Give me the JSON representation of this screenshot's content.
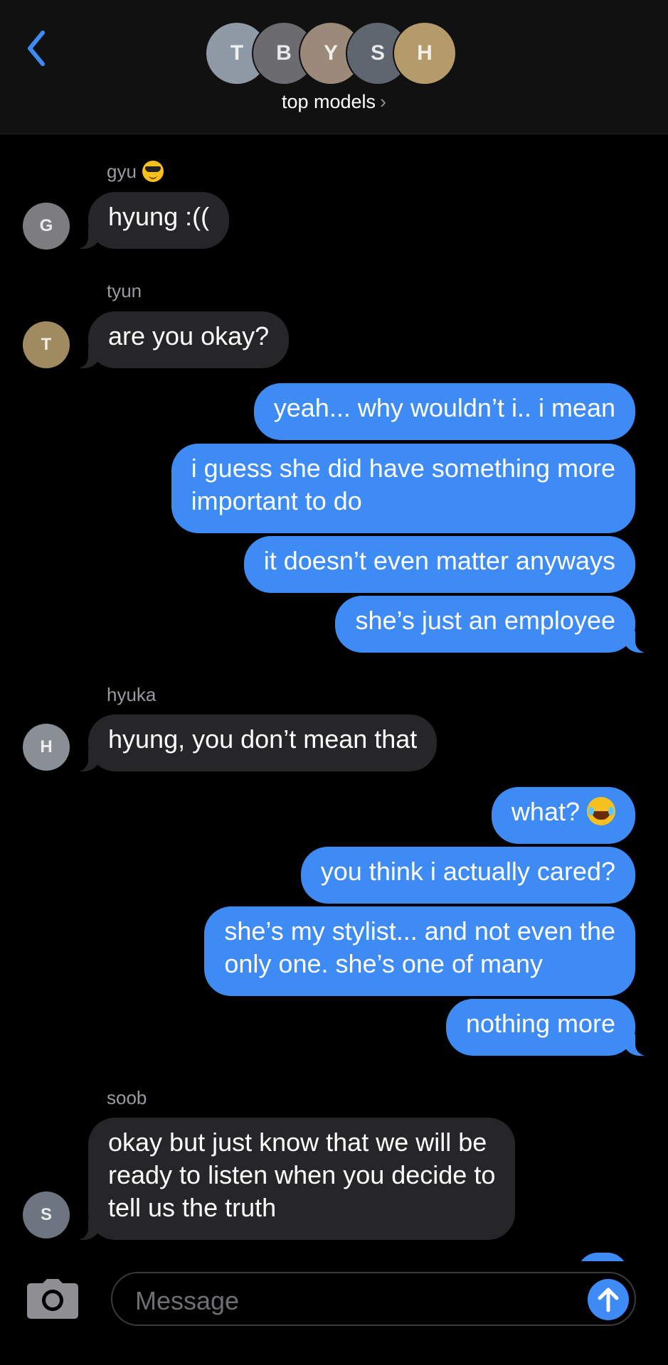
{
  "header": {
    "group_name": "top models",
    "chevron": "›",
    "back_icon": "chevron-left-icon",
    "avatars": [
      {
        "initial": "T",
        "color": "#8f9aa6"
      },
      {
        "initial": "B",
        "color": "#6c6c70"
      },
      {
        "initial": "Y",
        "color": "#9b8a7a"
      },
      {
        "initial": "S",
        "color": "#5f6670"
      },
      {
        "initial": "H",
        "color": "#b59a6a"
      }
    ]
  },
  "messages": {
    "gyu_name": "gyu",
    "gyu_emoji": "smiling-face-with-sunglasses",
    "gyu_msg": "hyung :((",
    "tyun_name": "tyun",
    "tyun_msg": "are you okay?",
    "me_1": "yeah... why wouldn’t i.. i mean",
    "me_2_line1": "i guess she did have something more",
    "me_2_line2": "important to do",
    "me_3": "it doesn’t even matter anyways",
    "me_4": "she’s just an employee",
    "hyuka_name": "hyuka",
    "hyuka_msg": "hyung, you don’t mean that",
    "me_5": "what?",
    "me_5_emoji": "face-with-tears-of-joy",
    "me_6": "you think i actually cared?",
    "me_7_line1": "she’s my stylist... and not even the",
    "me_7_line2": "only one. she’s one of many",
    "me_8": "nothing more",
    "soob_name": "soob",
    "soob_line1": "okay but just know that we will be",
    "soob_line2": "ready to listen when you decide to",
    "soob_line3": "tell us the truth"
  },
  "avatar_colors": {
    "gyu": "#7d7d80",
    "tyun": "#a08a60",
    "hyuka": "#8a8f95",
    "soob": "#6d7580"
  },
  "composer": {
    "placeholder": "Message",
    "camera_icon": "camera-icon",
    "send_icon": "arrow-up-icon"
  },
  "colors": {
    "outgoing_bubble": "#3e8bf6",
    "incoming_bubble": "#262629",
    "accent": "#3e8bf6"
  }
}
